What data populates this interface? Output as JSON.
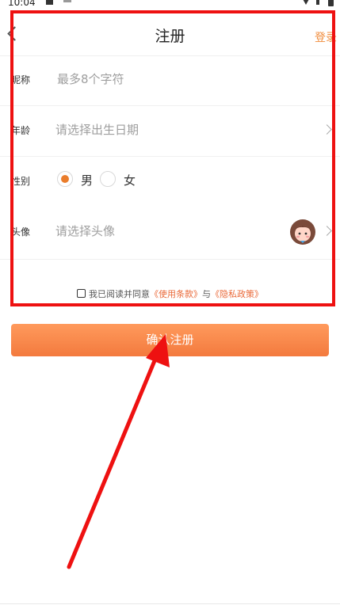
{
  "status_bar": {
    "time": "10:04"
  },
  "header": {
    "title": "注册",
    "login_label": "登录",
    "back_icon": "chevron-left-icon"
  },
  "form": {
    "nickname": {
      "label": "昵称",
      "placeholder": "最多8个字符"
    },
    "age": {
      "label": "年龄",
      "placeholder": "请选择出生日期"
    },
    "gender": {
      "label": "性别",
      "options": [
        {
          "label": "男",
          "selected": true
        },
        {
          "label": "女",
          "selected": false
        }
      ]
    },
    "avatar": {
      "label": "头像",
      "placeholder": "请选择头像",
      "icon": "cartoon-avatar-icon"
    }
  },
  "agreement": {
    "prefix": "我已阅读并同意",
    "terms_link": "《使用条款》",
    "connector": "与",
    "privacy_link": "《隐私政策》",
    "checked": false
  },
  "confirm_button": {
    "label": "确认注册"
  },
  "colors": {
    "accent": "#f08b3a",
    "button_gradient_top": "#ff9a5c",
    "button_gradient_bottom": "#f37a3e",
    "link": "#ea6a3a",
    "annotation_red": "#ee1111"
  }
}
